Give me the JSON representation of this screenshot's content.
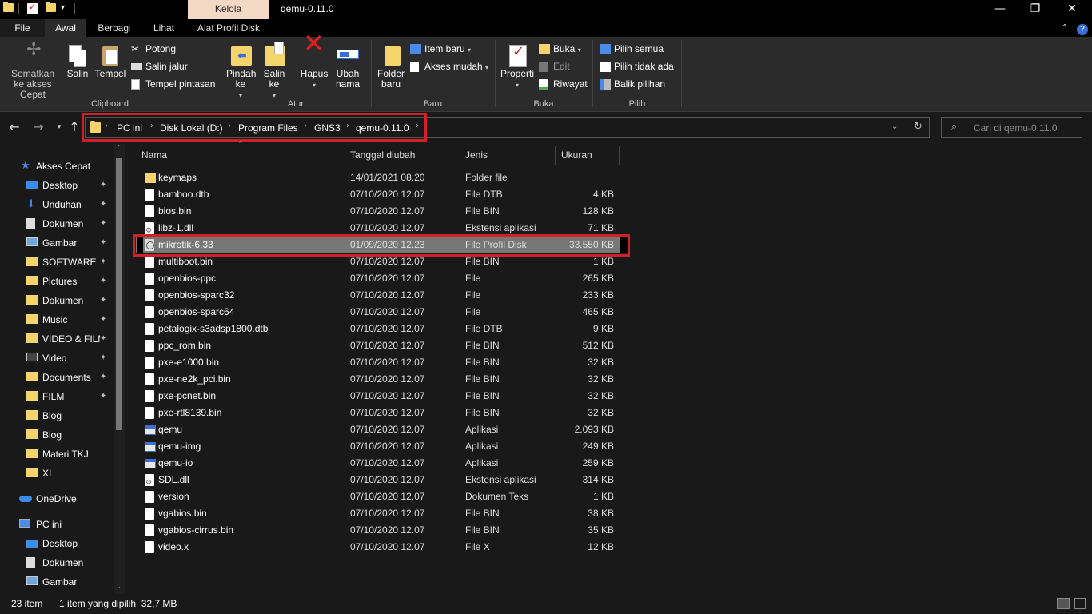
{
  "window": {
    "title": "qemu-0.11.0",
    "context_tab": "Kelola",
    "minimize_glyph": "—",
    "maximize_glyph": "❐",
    "close_glyph": "✕"
  },
  "ribbon_tabs": {
    "file": "File",
    "awal": "Awal",
    "berbagi": "Berbagi",
    "lihat": "Lihat",
    "alat_profil_disk": "Alat Profil Disk"
  },
  "ribbon": {
    "clipboard": {
      "label": "Clipboard",
      "sematkan": "Sematkan ke akses Cepat",
      "salin": "Salin",
      "tempel": "Tempel",
      "potong": "Potong",
      "salin_jalur": "Salin jalur",
      "tempel_pintasan": "Tempel pintasan"
    },
    "atur": {
      "label": "Atur",
      "pindah_ke": "Pindah ke",
      "salin_ke": "Salin ke",
      "hapus": "Hapus",
      "ubah_nama": "Ubah nama"
    },
    "baru": {
      "label": "Baru",
      "folder_baru": "Folder baru",
      "item_baru": "Item baru",
      "akses_mudah": "Akses mudah"
    },
    "buka": {
      "label": "Buka",
      "properti": "Properti",
      "buka": "Buka",
      "edit": "Edit",
      "riwayat": "Riwayat"
    },
    "pilih": {
      "label": "Pilih",
      "pilih_semua": "Pilih semua",
      "pilih_tidak_ada": "Pilih tidak ada",
      "balik_pilihan": "Balik pilihan"
    }
  },
  "breadcrumb": [
    "PC ini",
    "Disk Lokal (D:)",
    "Program Files",
    "GNS3",
    "qemu-0.11.0"
  ],
  "search": {
    "placeholder": "Cari di qemu-0.11.0"
  },
  "sidebar": {
    "quick_access": "Akses Cepat",
    "items": [
      {
        "label": "Desktop",
        "icon": "desktop-icon",
        "pinned": true
      },
      {
        "label": "Unduhan",
        "icon": "download-icon",
        "pinned": true
      },
      {
        "label": "Dokumen",
        "icon": "document-icon",
        "pinned": true
      },
      {
        "label": "Gambar",
        "icon": "picture-icon",
        "pinned": true
      },
      {
        "label": "SOFTWARE",
        "icon": "folder-icon",
        "pinned": true
      },
      {
        "label": "Pictures",
        "icon": "folder-icon",
        "pinned": true
      },
      {
        "label": "Dokumen",
        "icon": "folder-icon",
        "pinned": true
      },
      {
        "label": "Music",
        "icon": "folder-icon",
        "pinned": true
      },
      {
        "label": "VIDEO & FILM",
        "icon": "folder-icon",
        "pinned": true
      },
      {
        "label": "Video",
        "icon": "video-icon",
        "pinned": true
      },
      {
        "label": "Documents",
        "icon": "folder-icon",
        "pinned": true
      },
      {
        "label": "FILM",
        "icon": "folder-icon",
        "pinned": true
      },
      {
        "label": "Blog",
        "icon": "folder-icon",
        "pinned": false
      },
      {
        "label": "Blog",
        "icon": "folder-icon",
        "pinned": false
      },
      {
        "label": "Materi TKJ",
        "icon": "folder-icon",
        "pinned": false
      },
      {
        "label": "XI",
        "icon": "folder-icon",
        "pinned": false
      }
    ],
    "onedrive": "OneDrive",
    "pc": "PC ini",
    "pc_items": [
      {
        "label": "Desktop",
        "icon": "desktop-icon"
      },
      {
        "label": "Dokumen",
        "icon": "document-icon"
      },
      {
        "label": "Gambar",
        "icon": "picture-icon"
      }
    ]
  },
  "columns": {
    "name": "Nama",
    "date": "Tanggal diubah",
    "type": "Jenis",
    "size": "Ukuran"
  },
  "files": [
    {
      "name": "keymaps",
      "date": "14/01/2021 08.20",
      "type": "Folder file",
      "size": "",
      "icon": "folder"
    },
    {
      "name": "bamboo.dtb",
      "date": "07/10/2020 12.07",
      "type": "File DTB",
      "size": "4 KB",
      "icon": "doc"
    },
    {
      "name": "bios.bin",
      "date": "07/10/2020 12.07",
      "type": "File BIN",
      "size": "128 KB",
      "icon": "doc"
    },
    {
      "name": "libz-1.dll",
      "date": "07/10/2020 12.07",
      "type": "Ekstensi aplikasi",
      "size": "71 KB",
      "icon": "dll"
    },
    {
      "name": "mikrotik-6.33",
      "date": "01/09/2020 12.23",
      "type": "File Profil Disk",
      "size": "33.550 KB",
      "icon": "disk",
      "selected": true
    },
    {
      "name": "multiboot.bin",
      "date": "07/10/2020 12.07",
      "type": "File BIN",
      "size": "1 KB",
      "icon": "doc"
    },
    {
      "name": "openbios-ppc",
      "date": "07/10/2020 12.07",
      "type": "File",
      "size": "265 KB",
      "icon": "doc"
    },
    {
      "name": "openbios-sparc32",
      "date": "07/10/2020 12.07",
      "type": "File",
      "size": "233 KB",
      "icon": "doc"
    },
    {
      "name": "openbios-sparc64",
      "date": "07/10/2020 12.07",
      "type": "File",
      "size": "465 KB",
      "icon": "doc"
    },
    {
      "name": "petalogix-s3adsp1800.dtb",
      "date": "07/10/2020 12.07",
      "type": "File DTB",
      "size": "9 KB",
      "icon": "doc"
    },
    {
      "name": "ppc_rom.bin",
      "date": "07/10/2020 12.07",
      "type": "File BIN",
      "size": "512 KB",
      "icon": "doc"
    },
    {
      "name": "pxe-e1000.bin",
      "date": "07/10/2020 12.07",
      "type": "File BIN",
      "size": "32 KB",
      "icon": "doc"
    },
    {
      "name": "pxe-ne2k_pci.bin",
      "date": "07/10/2020 12.07",
      "type": "File BIN",
      "size": "32 KB",
      "icon": "doc"
    },
    {
      "name": "pxe-pcnet.bin",
      "date": "07/10/2020 12.07",
      "type": "File BIN",
      "size": "32 KB",
      "icon": "doc"
    },
    {
      "name": "pxe-rtl8139.bin",
      "date": "07/10/2020 12.07",
      "type": "File BIN",
      "size": "32 KB",
      "icon": "doc"
    },
    {
      "name": "qemu",
      "date": "07/10/2020 12.07",
      "type": "Aplikasi",
      "size": "2.093 KB",
      "icon": "app"
    },
    {
      "name": "qemu-img",
      "date": "07/10/2020 12.07",
      "type": "Aplikasi",
      "size": "249 KB",
      "icon": "app"
    },
    {
      "name": "qemu-io",
      "date": "07/10/2020 12.07",
      "type": "Aplikasi",
      "size": "259 KB",
      "icon": "app"
    },
    {
      "name": "SDL.dll",
      "date": "07/10/2020 12.07",
      "type": "Ekstensi aplikasi",
      "size": "314 KB",
      "icon": "dll"
    },
    {
      "name": "version",
      "date": "07/10/2020 12.07",
      "type": "Dokumen Teks",
      "size": "1 KB",
      "icon": "doc"
    },
    {
      "name": "vgabios.bin",
      "date": "07/10/2020 12.07",
      "type": "File BIN",
      "size": "38 KB",
      "icon": "doc"
    },
    {
      "name": "vgabios-cirrus.bin",
      "date": "07/10/2020 12.07",
      "type": "File BIN",
      "size": "35 KB",
      "icon": "doc"
    },
    {
      "name": "video.x",
      "date": "07/10/2020 12.07",
      "type": "File X",
      "size": "12 KB",
      "icon": "doc"
    }
  ],
  "status": {
    "count": "23 item",
    "selection": "1 item yang dipilih  32,7 MB"
  },
  "colors": {
    "highlight_red": "#d0202a",
    "selected_row": "#777777",
    "context_tab": "#f3d9c5"
  }
}
